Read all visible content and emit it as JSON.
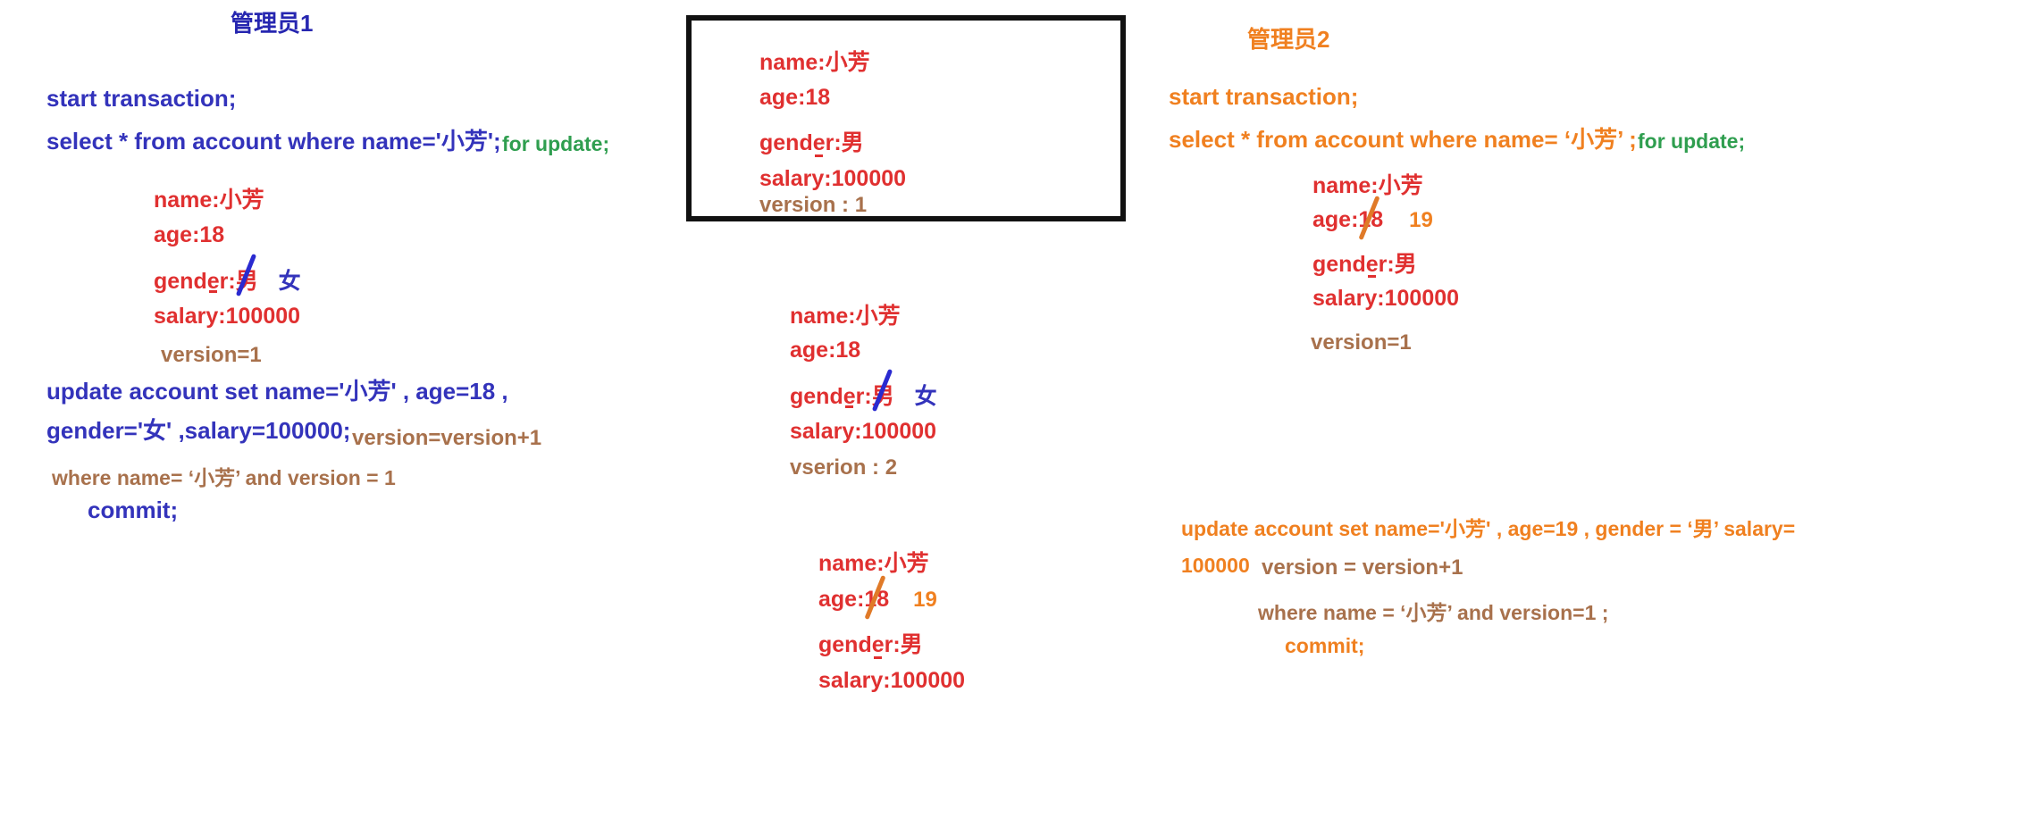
{
  "meta": {
    "diagram_title": "MySQL optimistic-lock / pessimistic-lock transaction comparison whiteboard",
    "background": "#ffffff"
  },
  "colors": {
    "blue": "#3333bb",
    "red": "#e03030",
    "brown": "#a8714c",
    "green": "#2f9e4f",
    "orange": "#f08020",
    "box_border": "#111111"
  },
  "left_panel": {
    "title": "管理员1",
    "sql_lines": [
      "start transaction;",
      "select * from account where name='小芳';"
    ],
    "for_update": "for update;",
    "result": {
      "name_label": "name:小芳",
      "age_label": "age:18",
      "gender_label": "gender:",
      "gender_value_struck": "男",
      "gender_correction": "女",
      "salary_label": "salary:100000",
      "version_label": "version=1"
    },
    "update_stmt": {
      "line1": "update account  set name='小芳' , age=18 ,",
      "line2": "gender='女' ,salary=100000;",
      "version_tail": "version=version+1",
      "line3": "where name= ‘小芳’  and version = 1",
      "commit": "commit;"
    }
  },
  "center_panel": {
    "boxed_result": {
      "name_label": "name:小芳",
      "age_label": "age:18",
      "gender_label": "gender:男",
      "salary_label": "salary:100000",
      "version_label": "version : 1"
    },
    "result_v2": {
      "name_label": "name:小芳",
      "age_label": "age:18",
      "gender_label": "gender:",
      "gender_value_struck": "男",
      "gender_correction": "女",
      "salary_label": "salary:100000",
      "version_label": "vserion : 2"
    },
    "result_v3": {
      "name_label": "name:小芳",
      "age_label": "age:",
      "age_value_struck": "18",
      "age_correction": "19",
      "gender_label": "gender:男",
      "salary_label": "salary:100000"
    }
  },
  "right_panel": {
    "title": "管理员2",
    "sql_lines": [
      "start transaction;",
      "select * from account where name=  ‘小芳’ ;"
    ],
    "for_update": "for update;",
    "result": {
      "name_label": "name:小芳",
      "age_label": "age:",
      "age_value_struck": "18",
      "age_correction": "19",
      "gender_label": "gender:男",
      "salary_label": "salary:100000",
      "version_label": "version=1"
    },
    "update_stmt": {
      "line1": "update account set name='小芳' , age=19 , gender =  ‘男’  salary=",
      "line2_prefix": "100000",
      "line2_tail": "version = version+1",
      "line3": "where name =  ‘小芳’   and version=1 ;",
      "commit": "commit;"
    }
  }
}
